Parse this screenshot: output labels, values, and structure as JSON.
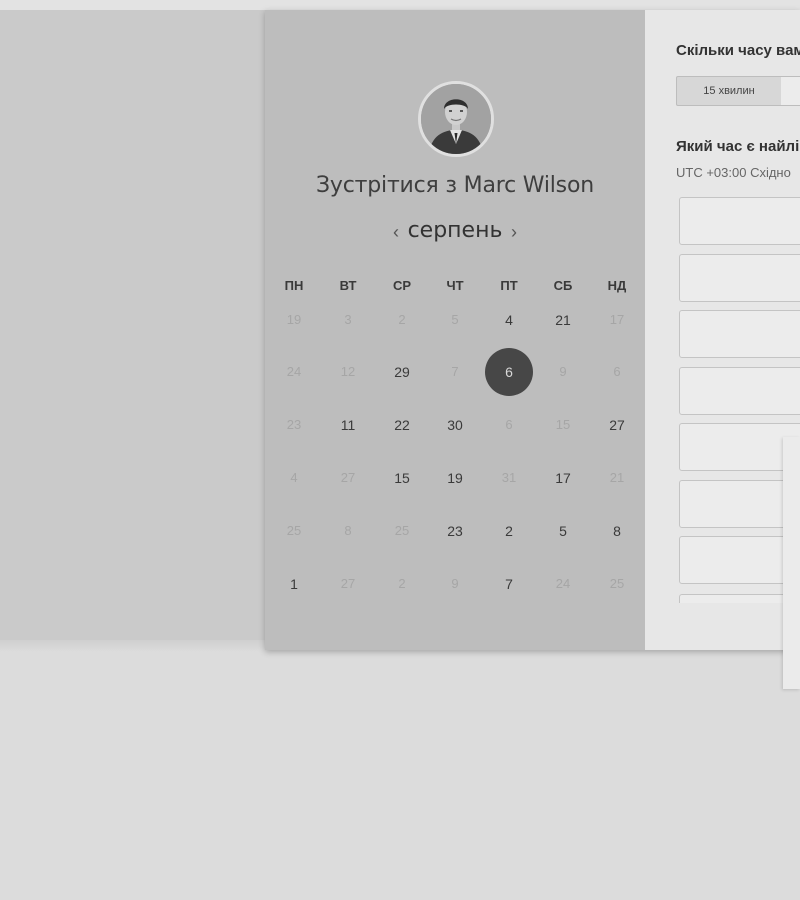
{
  "booking": {
    "title": "Зустрітися з Marc Wilson",
    "host_name": "Marc Wilson",
    "avatar_icon": "profile-photo"
  },
  "calendar": {
    "month_label": "серпень",
    "prev_icon": "chevron-left",
    "next_icon": "chevron-right",
    "prev_glyph": "‹",
    "next_glyph": "›",
    "weekdays": [
      "ПН",
      "ВТ",
      "СР",
      "ЧТ",
      "ПТ",
      "СБ",
      "НД"
    ],
    "weeks": [
      [
        {
          "d": "19",
          "m": true
        },
        {
          "d": "3",
          "m": true
        },
        {
          "d": "2",
          "m": true
        },
        {
          "d": "5",
          "m": true
        },
        {
          "d": "4",
          "m": false
        },
        {
          "d": "21",
          "m": false
        },
        {
          "d": "17",
          "m": true
        }
      ],
      [
        {
          "d": "24",
          "m": true
        },
        {
          "d": "12",
          "m": true
        },
        {
          "d": "29",
          "m": false
        },
        {
          "d": "7",
          "m": true
        },
        {
          "d": "6",
          "m": false,
          "s": true
        },
        {
          "d": "9",
          "m": true
        },
        {
          "d": "6",
          "m": true
        }
      ],
      [
        {
          "d": "23",
          "m": true
        },
        {
          "d": "11",
          "m": false
        },
        {
          "d": "22",
          "m": false
        },
        {
          "d": "30",
          "m": false
        },
        {
          "d": "6",
          "m": true
        },
        {
          "d": "15",
          "m": true
        },
        {
          "d": "27",
          "m": false
        }
      ],
      [
        {
          "d": "4",
          "m": true
        },
        {
          "d": "27",
          "m": true
        },
        {
          "d": "15",
          "m": false
        },
        {
          "d": "19",
          "m": false
        },
        {
          "d": "31",
          "m": true
        },
        {
          "d": "17",
          "m": false
        },
        {
          "d": "21",
          "m": true
        }
      ],
      [
        {
          "d": "25",
          "m": true
        },
        {
          "d": "8",
          "m": true
        },
        {
          "d": "25",
          "m": true
        },
        {
          "d": "23",
          "m": false
        },
        {
          "d": "2",
          "m": false
        },
        {
          "d": "5",
          "m": false
        },
        {
          "d": "8",
          "m": false
        }
      ],
      [
        {
          "d": "1",
          "m": false
        },
        {
          "d": "27",
          "m": true
        },
        {
          "d": "2",
          "m": true
        },
        {
          "d": "9",
          "m": true
        },
        {
          "d": "7",
          "m": false
        },
        {
          "d": "24",
          "m": true
        },
        {
          "d": "25",
          "m": true
        }
      ]
    ],
    "selected_day": "6"
  },
  "duration": {
    "question": "Скільки часу вам",
    "options": [
      "15 хвилин",
      ""
    ],
    "selected": "15 хвилин"
  },
  "time": {
    "question": "Який час є найлі",
    "timezone": "UTC +03:00 Східно",
    "slot_count": 8
  },
  "colors": {
    "selected_day_bg": "#474747",
    "left_pane_bg": "#bdbdbd",
    "right_pane_bg": "#e7e7e7"
  }
}
